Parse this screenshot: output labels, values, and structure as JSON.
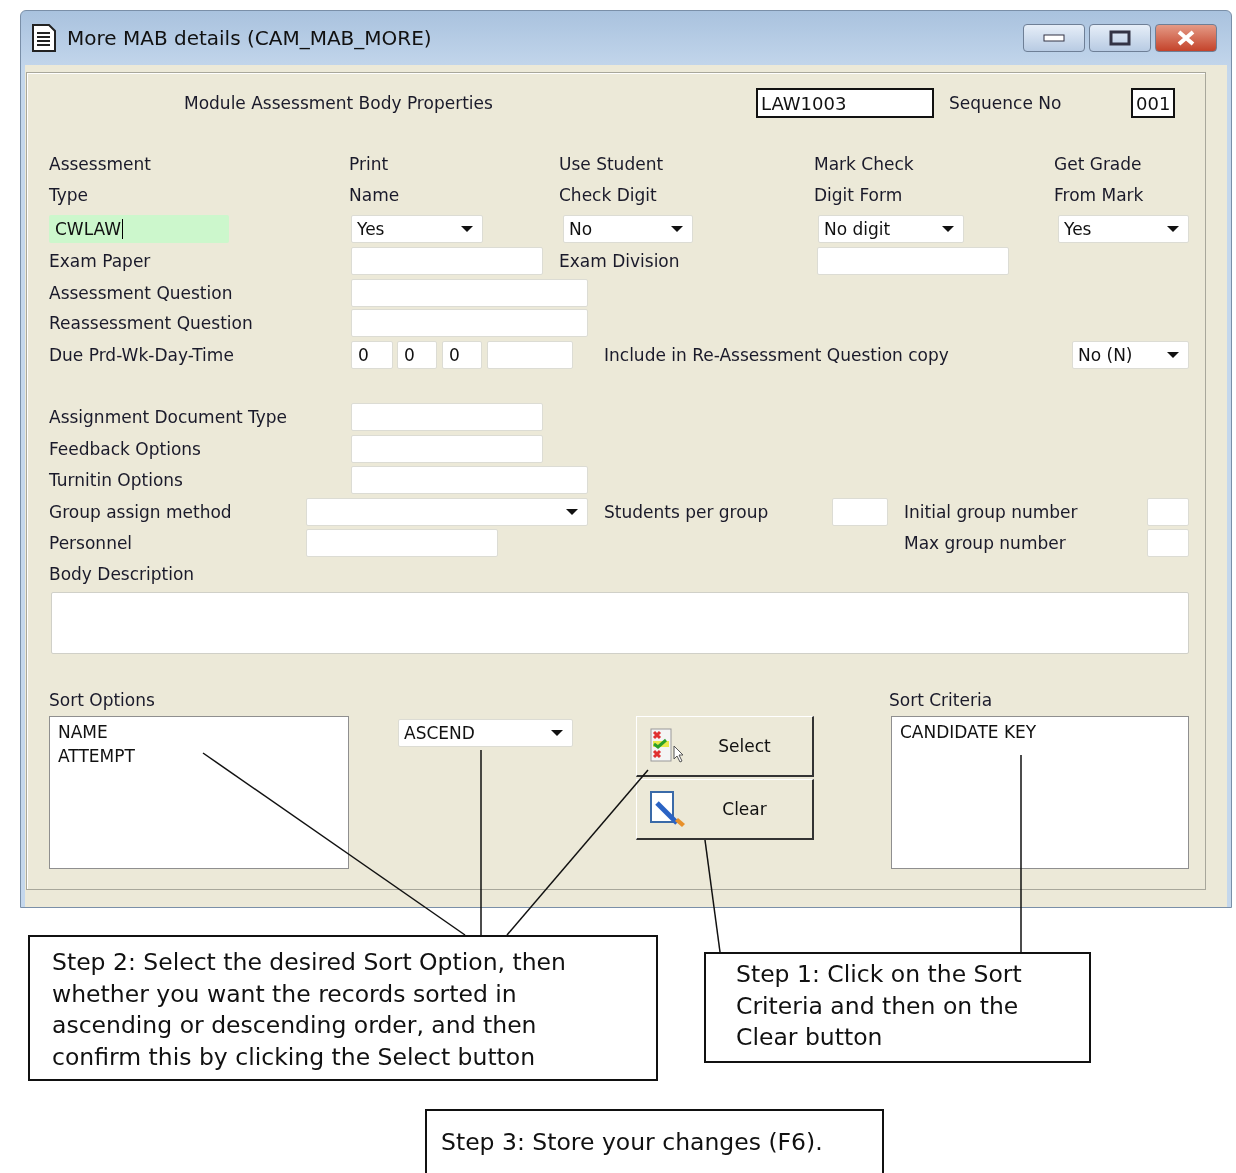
{
  "window": {
    "title": "More MAB details (CAM_MAB_MORE)"
  },
  "header": {
    "title": "Module Assessment Body Properties",
    "module_code": "LAW1003",
    "sequence_label": "Sequence No",
    "sequence_no": "001"
  },
  "columns": [
    {
      "heading": "Assessment Type",
      "kind": "text",
      "value": "CWLAW",
      "focused": true
    },
    {
      "heading": "Print Name",
      "kind": "dropdown",
      "value": "Yes",
      "focused": false
    },
    {
      "heading": "Use Student Check Digit",
      "kind": "dropdown",
      "value": "No",
      "focused": false
    },
    {
      "heading": "Mark Check Digit Form",
      "kind": "dropdown",
      "value": "No digit",
      "focused": false
    },
    {
      "heading": "Get Grade From Mark",
      "kind": "dropdown",
      "value": "Yes",
      "focused": false
    }
  ],
  "rows": [
    [
      {
        "kind": "label",
        "text": "Exam Paper"
      },
      {
        "kind": "field"
      },
      {
        "kind": "label",
        "text": "Exam Division"
      },
      {
        "kind": "field"
      }
    ],
    [
      {
        "kind": "label",
        "text": "Assessment Question"
      },
      {
        "kind": "field"
      }
    ],
    [
      {
        "kind": "label",
        "text": "Reassessment Question"
      },
      {
        "kind": "field"
      }
    ],
    [
      {
        "kind": "label",
        "text": "Due Prd-Wk-Day-Time"
      },
      {
        "kind": "field",
        "value": "0"
      },
      {
        "kind": "field",
        "value": "0"
      },
      {
        "kind": "field",
        "value": "0"
      },
      {
        "kind": "field"
      },
      {
        "kind": "label",
        "text": "Include in Re-Assessment Question copy"
      },
      {
        "kind": "dropdown",
        "value": "No (N)"
      }
    ],
    [
      {
        "kind": "label",
        "text": "Assignment Document Type"
      },
      {
        "kind": "field"
      }
    ],
    [
      {
        "kind": "label",
        "text": "Feedback Options"
      },
      {
        "kind": "field"
      }
    ],
    [
      {
        "kind": "label",
        "text": "Turnitin Options"
      },
      {
        "kind": "field"
      }
    ],
    [
      {
        "kind": "label",
        "text": "Group assign method"
      },
      {
        "kind": "dropdown"
      },
      {
        "kind": "label",
        "text": "Students per group"
      },
      {
        "kind": "field"
      },
      {
        "kind": "label",
        "text": "Initial group number"
      },
      {
        "kind": "field"
      }
    ],
    [
      {
        "kind": "label",
        "text": "Personnel"
      },
      {
        "kind": "field"
      },
      {
        "kind": "label",
        "text": "Max group number"
      },
      {
        "kind": "field"
      }
    ]
  ],
  "description_label": "Body Description",
  "sort": {
    "options_label": "Sort Options",
    "options": [
      {
        "text": "NAME"
      },
      {
        "text": "ATTEMPT"
      }
    ],
    "order": "ASCEND",
    "buttons": [
      {
        "label": "Select",
        "kind": "select"
      },
      {
        "label": "Clear",
        "kind": "clear"
      }
    ],
    "criteria_label": "Sort Criteria",
    "criteria": [
      {
        "text": "CANDIDATE KEY"
      }
    ]
  },
  "callouts": [
    {
      "text": "Step 2: Select the desired Sort Option, then whether you want the records sorted in ascending or descending order, and then confirm this by clicking the Select button"
    },
    {
      "text": "Step 1: Click on the Sort Criteria and then on the Clear button"
    },
    {
      "text": "Step 3: Store your changes (F6)."
    }
  ]
}
